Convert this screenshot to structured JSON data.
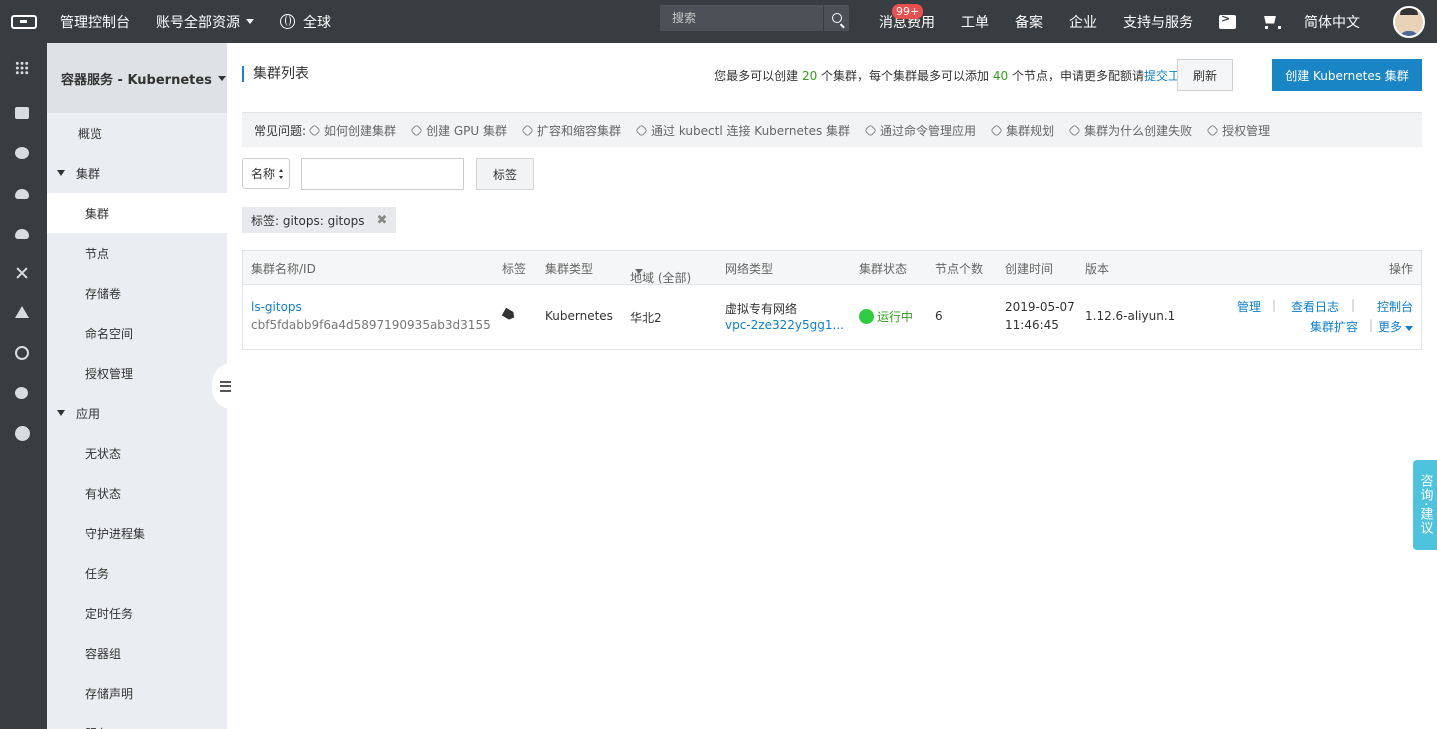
{
  "topbar": {
    "console": "管理控制台",
    "account_resources": "账号全部资源",
    "region": "全球",
    "search_placeholder": "搜索",
    "messages": "消息",
    "messages_badge": "99+",
    "billing": "费用",
    "tickets": "工单",
    "icp": "备案",
    "enterprise": "企业",
    "support": "支持与服务",
    "language": "简体中文"
  },
  "sidebar": {
    "title": "容器服务 - Kubernetes",
    "overview": "概览",
    "cluster_group": "集群",
    "cluster_items": [
      "集群",
      "节点",
      "存储卷",
      "命名空间",
      "授权管理"
    ],
    "app_group": "应用",
    "app_items": [
      "无状态",
      "有状态",
      "守护进程集",
      "任务",
      "定时任务",
      "容器组",
      "存储声明",
      "服务"
    ]
  },
  "page": {
    "title": "集群列表",
    "quota_pre": "您最多可以创建 ",
    "quota_clusters": "20",
    "quota_mid": " 个集群，每个集群最多可以添加 ",
    "quota_nodes": "40",
    "quota_post": " 个节点，申请更多配额请",
    "quota_link": "提交工单",
    "refresh": "刷新",
    "create": "创建 Kubernetes 集群"
  },
  "faq": {
    "label": "常见问题:",
    "links": [
      "如何创建集群",
      "创建 GPU 集群",
      "扩容和缩容集群",
      "通过 kubectl 连接 Kubernetes 集群",
      "通过命令管理应用",
      "集群规划",
      "集群为什么创建失败",
      "授权管理"
    ]
  },
  "filter": {
    "select_value": "名称",
    "input_value": "",
    "tag_button": "标签",
    "active_tag": "标签: gitops: gitops"
  },
  "table": {
    "headers": {
      "name": "集群名称/ID",
      "tags": "标签",
      "type": "集群类型",
      "region": "地域 (全部)",
      "network": "网络类型",
      "status": "集群状态",
      "nodes": "节点个数",
      "created": "创建时间",
      "version": "版本",
      "actions": "操作"
    },
    "rows": [
      {
        "name": "ls-gitops",
        "id": "cbf5fdabb9f6a4d5897190935ab3d3155",
        "type": "Kubernetes",
        "region": "华北2",
        "network": "虚拟专有网络",
        "vpc": "vpc-2ze322y5gg1...",
        "status": "运行中",
        "nodes": "6",
        "created_date": "2019-05-07",
        "created_time": "11:46:45",
        "version": "1.12.6-aliyun.1",
        "actions": {
          "manage": "管理",
          "logs": "查看日志",
          "console": "控制台",
          "scale": "集群扩容",
          "more": "更多"
        }
      }
    ]
  },
  "consult": "咨询·建议",
  "colors": {
    "topbar": "#373d41",
    "accent": "#1a85c4",
    "link": "#0e7fcf",
    "success": "#2fa11a"
  }
}
